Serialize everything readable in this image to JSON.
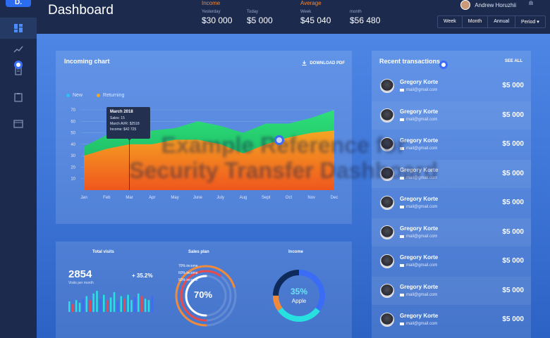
{
  "header": {
    "title": "Dashboard",
    "income": {
      "label": "Income",
      "yesterday_label": "Yesterday",
      "yesterday_value": "$30 000",
      "today_label": "Today",
      "today_value": "$5 000"
    },
    "average": {
      "label": "Average",
      "week_label": "Week",
      "week_value": "$45 040",
      "month_label": "month",
      "month_value": "$56 480"
    },
    "user_name": "Andrew Horuzhii",
    "periods": [
      "Week",
      "Month",
      "Annual",
      "Period ▾"
    ]
  },
  "sidebar": {
    "logo": "D.",
    "items": [
      "dashboard-icon",
      "trending-up-icon",
      "document-icon",
      "clipboard-icon",
      "calendar-icon"
    ]
  },
  "incoming_chart": {
    "title": "Incoming chart",
    "download_label": "DOWNLOAD PDF",
    "legend": [
      {
        "name": "New",
        "color": "#2ec0f0"
      },
      {
        "name": "Returning",
        "color": "#f5a623"
      }
    ],
    "tooltip": {
      "title": "March 2018",
      "lines": [
        "Sales: 15",
        "March AVR: $2518",
        "Income: $42 725"
      ]
    }
  },
  "chart_data": {
    "type": "area",
    "categories": [
      "Jan",
      "Feb",
      "Mar",
      "Apr",
      "May",
      "June",
      "July",
      "Aug",
      "Sept",
      "Oct",
      "Nov",
      "Dec"
    ],
    "ylim": [
      0,
      70
    ],
    "yticks": [
      10,
      20,
      30,
      40,
      50,
      60,
      70
    ],
    "grid": true,
    "legend": "top-left",
    "series": [
      {
        "name": "New",
        "color": "#22c46a",
        "values": [
          38,
          48,
          46,
          52,
          54,
          60,
          56,
          50,
          58,
          58,
          63,
          70
        ]
      },
      {
        "name": "Returning",
        "color": "#f0772a",
        "values": [
          30,
          36,
          40,
          40,
          44,
          44,
          40,
          32,
          40,
          46,
          50,
          52
        ]
      }
    ]
  },
  "watermark": {
    "line1": "Example Reference for",
    "line2": "Security Transfer Dashboard"
  },
  "transactions": {
    "title": "Recent transactions",
    "see_all": "SEE ALL",
    "items": [
      {
        "name": "Gregory Korte",
        "email": "mail@gmail.com",
        "amount": "$5 000"
      },
      {
        "name": "Gregory Korte",
        "email": "mail@gmail.com",
        "amount": "$5 000"
      },
      {
        "name": "Gregory Korte",
        "email": "mail@gmail.com",
        "amount": "$5 000"
      },
      {
        "name": "Gregory Korte",
        "email": "mail@gmail.com",
        "amount": "$5 000"
      },
      {
        "name": "Gregory Korte",
        "email": "mail@gmail.com",
        "amount": "$5 000"
      },
      {
        "name": "Gregory Korte",
        "email": "mail@gmail.com",
        "amount": "$5 000"
      },
      {
        "name": "Gregory Korte",
        "email": "mail@gmail.com",
        "amount": "$5 000"
      },
      {
        "name": "Gregory Korte",
        "email": "mail@gmail.com",
        "amount": "$5 000"
      },
      {
        "name": "Gregory Korte",
        "email": "mail@gmail.com",
        "amount": "$5 000"
      }
    ]
  },
  "total_visits": {
    "title": "Total visits",
    "value": "2854",
    "change": "+ 35.2%",
    "sub": "Visits per month",
    "bars": [
      8,
      6,
      9,
      7,
      10,
      12,
      9,
      14,
      16,
      10,
      13,
      9,
      11,
      15,
      8,
      12,
      10,
      13,
      9,
      11,
      14,
      12,
      10,
      9,
      12
    ]
  },
  "sales_plan": {
    "title": "Sales plan",
    "rings": [
      {
        "label": "70% income",
        "value": 0.7,
        "color": "#f08a3a"
      },
      {
        "label": "60% income",
        "value": 0.6,
        "color": "#e84a4a"
      },
      {
        "label": "50% income",
        "value": 0.5,
        "color": "#ffffff"
      }
    ],
    "center": "70%"
  },
  "income_donut": {
    "title": "Income",
    "value": 0.35,
    "center_pct": "35%",
    "center_label": "Apple",
    "colors": [
      "#3b6cf5",
      "#27e0e0",
      "#f08a3a",
      "#0e2a5a"
    ]
  },
  "colors": {
    "accent": "#2c6cf0",
    "orange": "#f08a3a",
    "green": "#22c46a"
  }
}
